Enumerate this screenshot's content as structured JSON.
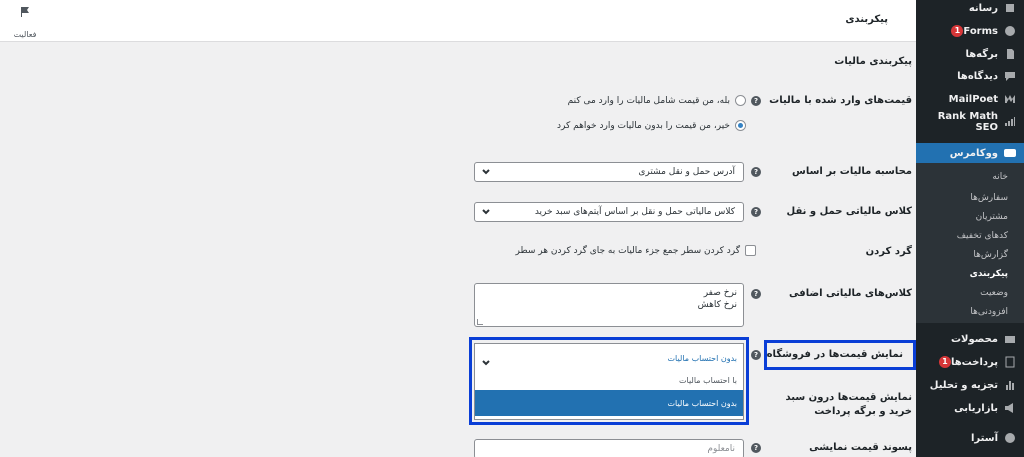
{
  "sidebar": {
    "items": [
      {
        "label": "رسانه",
        "icon": "media-icon"
      },
      {
        "label": "Forms",
        "icon": "forms-icon",
        "badge": "1"
      },
      {
        "label": "برگه‌ها",
        "icon": "pages-icon"
      },
      {
        "label": "دیدگاه‌ها",
        "icon": "comments-icon"
      },
      {
        "label": "MailPoet",
        "icon": "mailpoet-icon"
      },
      {
        "label": "Rank Math SEO",
        "icon": "rank-math-icon"
      },
      {
        "label": "ووکامرس",
        "icon": "woocommerce-icon"
      },
      {
        "label": "محصولات",
        "icon": "products-icon"
      },
      {
        "label": "پرداخت‌ها",
        "icon": "payments-icon",
        "badge": "1"
      },
      {
        "label": "تجزیه و تحلیل",
        "icon": "analytics-icon"
      },
      {
        "label": "بازاریابی",
        "icon": "marketing-icon"
      },
      {
        "label": "آسترا",
        "icon": "astra-icon"
      }
    ],
    "submenu": [
      "خانه",
      "سفارش‌ها",
      "مشتریان",
      "کدهای تخفیف",
      "گزارش‌ها",
      "پیکربندی",
      "وضعیت",
      "افزودنی‌ها"
    ]
  },
  "topbar": {
    "title": "پیکربندی",
    "activity_label": "فعالیت"
  },
  "main": {
    "section_title": "پیکربندی مالیات",
    "prices_entered": {
      "label": "قیمت‌های وارد شده با مالیات",
      "option_yes": "بله، من قیمت شامل مالیات را وارد می کنم",
      "option_no": "خیر، من قیمت را بدون مالیات وارد خواهم کرد"
    },
    "calc_based": {
      "label": "محاسبه مالیات بر اساس",
      "value": "آدرس حمل و نقل مشتری"
    },
    "shipping_class": {
      "label": "کلاس مالیاتی حمل و نقل",
      "value": "کلاس مالیاتی حمل و نقل بر اساس آیتم‌های سبد خرید"
    },
    "rounding": {
      "label": "گرد کردن",
      "checkbox_label": "گرد کردن سطر جمع جزء مالیات به جای گرد کردن هر سطر"
    },
    "additional_classes": {
      "label": "کلاس‌های مالیاتی اضافی",
      "line1": "نرخ صفر",
      "line2": "نرخ کاهش"
    },
    "display_shop": {
      "label": "نمایش قیمت‌ها در فروشگاه",
      "value": "بدون احتساب مالیات",
      "options": [
        "با احتساب مالیات",
        "بدون احتساب مالیات"
      ]
    },
    "display_cart": {
      "label_line1": "نمایش قیمت‌ها درون سبد",
      "label_line2": "خرید و برگه پرداخت"
    },
    "price_suffix": {
      "label": "پسوند قیمت نمایشی",
      "placeholder": "نامعلوم"
    }
  },
  "colors": {
    "accent": "#2271b1",
    "highlight": "#0a3ed6",
    "sidebar_bg": "#1d2327"
  }
}
